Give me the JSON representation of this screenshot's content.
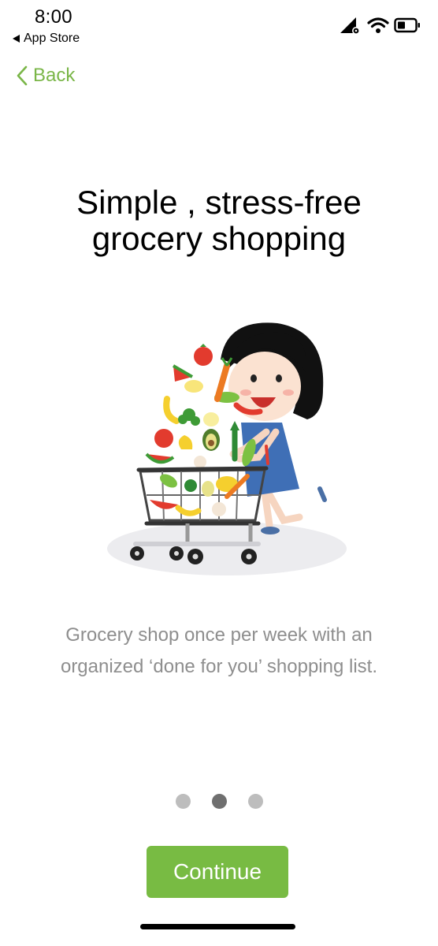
{
  "status_bar": {
    "time": "8:00",
    "back_app_label": "App Store",
    "icons": [
      "signal-icon",
      "wifi-icon",
      "battery-icon"
    ]
  },
  "nav": {
    "back_label": "Back"
  },
  "onboarding": {
    "title_line1": "Simple , stress-free",
    "title_line2": "grocery shopping",
    "illustration": "girl-pushing-grocery-cart-illustration",
    "description_line1": "Grocery shop once per week with an",
    "description_line2": "organized ‘done for you’ shopping list.",
    "page_count": 3,
    "current_page": 2
  },
  "cta": {
    "label": "Continue"
  },
  "colors": {
    "accent": "#78bb43",
    "back_link": "#7ab648",
    "body_text": "#8e8e8e",
    "dot_inactive": "#bdbdbd",
    "dot_active": "#6f6f6f"
  }
}
